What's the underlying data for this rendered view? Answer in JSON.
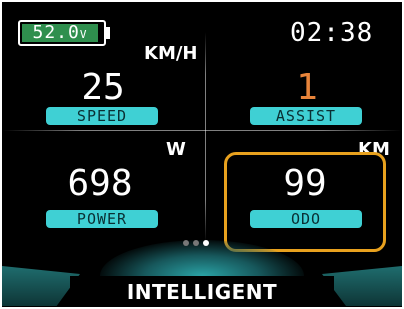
{
  "status": {
    "battery_voltage": "52.0",
    "battery_unit": "V",
    "clock": "02:38"
  },
  "speed": {
    "unit": "KM/H",
    "value": "25",
    "label": "SPEED"
  },
  "assist": {
    "value": "1",
    "label": "ASSIST"
  },
  "power": {
    "unit": "W",
    "value": "698",
    "label": "POWER"
  },
  "odo": {
    "unit": "KM",
    "value": "99",
    "label": "ODO"
  },
  "mode": {
    "label": "INTELLIGENT"
  },
  "colors": {
    "accent_cyan": "#3fd0d4",
    "assist_orange": "#e8843a",
    "battery_green": "#2f8f4e",
    "highlight_frame": "#e8a11e"
  },
  "page_indicator": {
    "count": 3,
    "active_index": 2
  }
}
